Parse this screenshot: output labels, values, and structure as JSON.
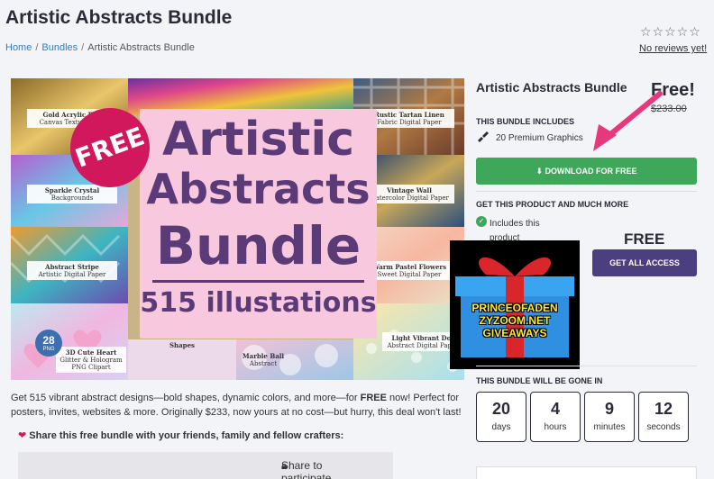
{
  "page": {
    "title": "Artistic Abstracts Bundle"
  },
  "breadcrumb": {
    "home": "Home",
    "bundles": "Bundles",
    "current": "Artistic Abstracts Bundle",
    "sep": "/"
  },
  "reviews": {
    "stars": "☆☆☆☆☆",
    "text": "No reviews yet!"
  },
  "hero": {
    "badge": "FREE",
    "line1": "Artistic",
    "line2": "Abstracts",
    "line3": "Bundle",
    "line4": "515 illustations",
    "count_badge": "28",
    "count_sub": "PNG",
    "tiles": {
      "t1": "Gold Acrylic Pou",
      "t1s": "Canvas Texture Sam",
      "t2": "Rustic Tartan Linen",
      "t2s": "Fabric Digital Paper",
      "t3": "Sparkle Crystal",
      "t3s": "Backgrounds",
      "t4": "Vintage Wall",
      "t4s": "Watercolor Digital Paper",
      "t5": "Abstract Stripe",
      "t5s": "Artistic Digital Paper",
      "t6": "Warm Pastel Flowers",
      "t6s": "Sweet Digital Paper",
      "t7": "3D Cute Heart",
      "t7s": "Glitter & Hologram PNG Clipart",
      "t8": "Shapes",
      "t9": "Marble Ball",
      "t9s": "Abstract",
      "t10": "Light Vibrant Dot",
      "t10s": "Abstract Digital Paper"
    }
  },
  "gift": {
    "line1": "PRINCEOFADEN",
    "line2": "ZYZOOM.NET",
    "line3": "GIVEAWAYS"
  },
  "description": {
    "before": "Get 515 vibrant abstract designs—bold shapes, dynamic colors, and more—for ",
    "bold": "FREE",
    "after": " now! Perfect for posters, invites, websites & more. Originally $233, now yours at no cost—but hurry, this deal won't last!"
  },
  "share": {
    "heading": "Share this free bundle with your friends, family and fellow crafters:",
    "box": "Share to participate"
  },
  "product": {
    "title": "Artistic Abstracts Bundle",
    "price": "Free!",
    "old_price": "$233.00",
    "includes_heading": "THIS BUNDLE INCLUDES",
    "includes_item": "20 Premium Graphics",
    "download": "DOWNLOAD FOR FREE",
    "more_heading": "GET THIS PRODUCT AND MUCH MORE",
    "included_text": "Includes this product",
    "access_price": "FREE",
    "get_all": "GET ALL ACCESS",
    "gone_heading": "THIS BUNDLE WILL BE GONE IN"
  },
  "countdown": [
    {
      "value": "20",
      "unit": "days"
    },
    {
      "value": "4",
      "unit": "hours"
    },
    {
      "value": "9",
      "unit": "minutes"
    },
    {
      "value": "12",
      "unit": "seconds"
    }
  ],
  "colors": {
    "download": "#3fa75a",
    "get_all": "#4b3f80",
    "arrow": "#e8377d",
    "link": "#2d7ec4"
  },
  "icons": {
    "brush": "paintbrush-icon",
    "download": "download-icon",
    "check": "check-circle-icon",
    "lock": "lock-icon",
    "heart": "heart-icon",
    "star": "star-outline-icon"
  }
}
